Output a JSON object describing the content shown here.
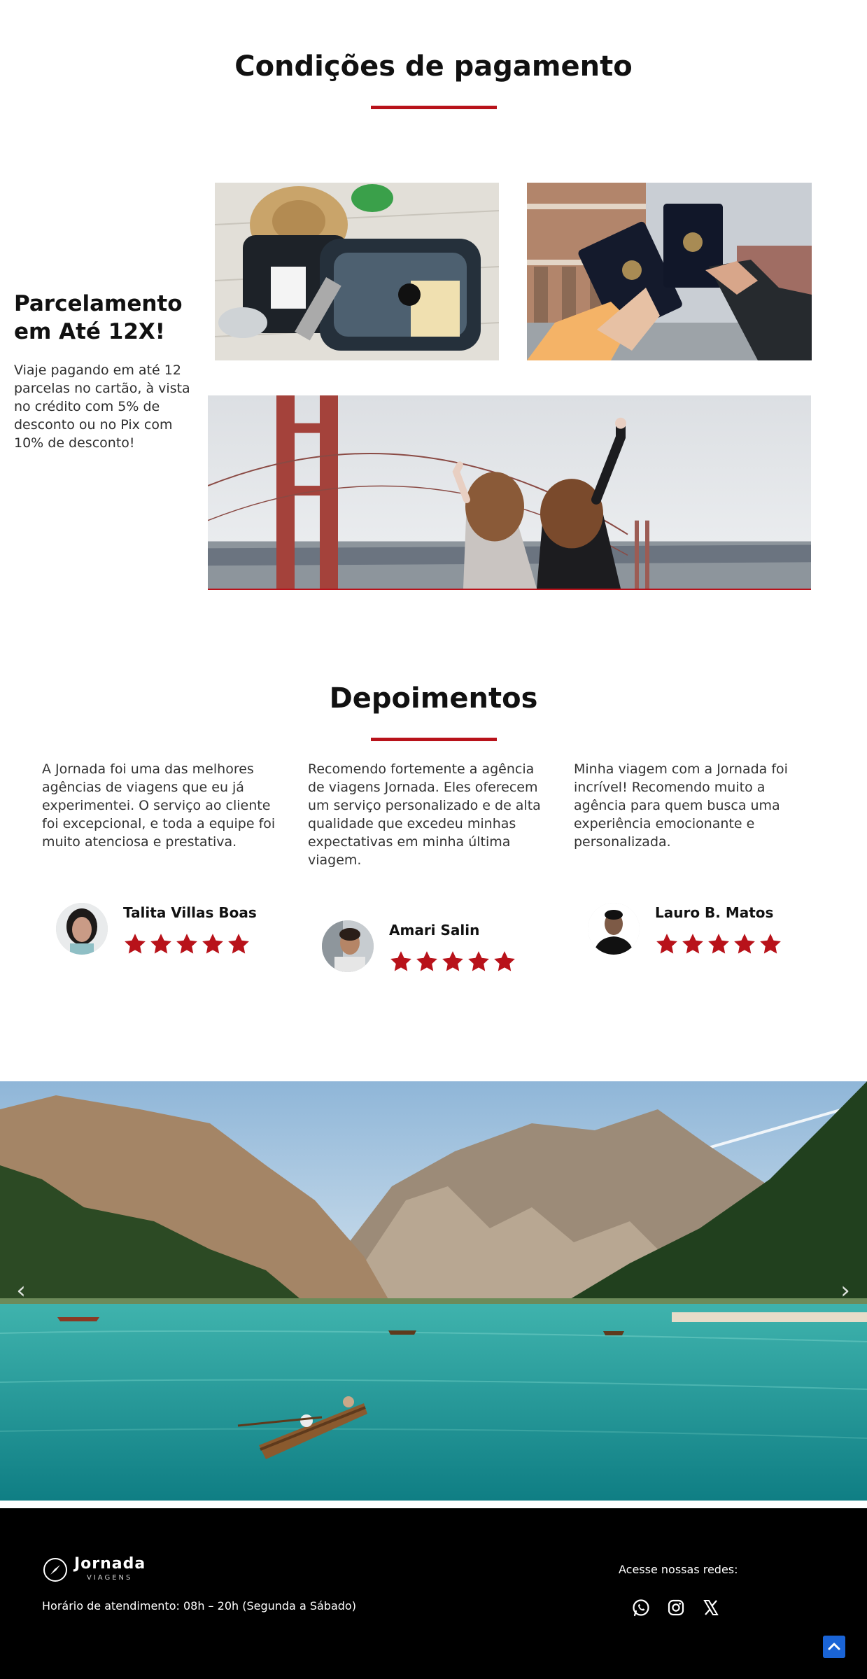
{
  "payment": {
    "title": "Condições de pagamento",
    "installments_heading": "Parcelamento em Até 12X!",
    "installments_text": "Viaje pagando em até 12 parcelas no cartão, à vista no crédito com 5% de desconto ou no Pix com 10% de desconto!"
  },
  "testimonials": {
    "title": "Depoimentos",
    "items": [
      {
        "quote": "A Jornada foi uma das melhores agências de viagens que eu já experimentei. O serviço ao cliente foi excepcional, e toda a equipe foi muito atenciosa e prestativa.",
        "name": "Talita Villas Boas",
        "rating": 5
      },
      {
        "quote": "Recomendo fortemente a agência de viagens Jornada. Eles oferecem um serviço personalizado e de alta qualidade que excedeu minhas expectativas em minha última viagem.",
        "name": "Amari Salin",
        "rating": 5
      },
      {
        "quote": "Minha viagem com a Jornada foi incrível! Recomendo muito a agência para quem busca uma experiência emocionante e personalizada.",
        "name": "Lauro B. Matos",
        "rating": 5
      }
    ]
  },
  "carousel": {
    "prev_icon": "chevron-left-icon",
    "next_icon": "chevron-right-icon",
    "prev_glyph": "‹",
    "next_glyph": "›"
  },
  "footer": {
    "logo_word": "Jornada",
    "logo_sub": "VIAGENS",
    "hours": "Horário de atendimento: 08h – 20h (Segunda a Sábado)",
    "social_label": "Acesse nossas redes:",
    "social_icons": [
      "whatsapp-icon",
      "instagram-icon",
      "x-icon"
    ]
  },
  "colors": {
    "accent": "#b8121a",
    "star": "#b8121a",
    "footer_bg": "#000000",
    "back_to_top": "#1a64d6"
  }
}
